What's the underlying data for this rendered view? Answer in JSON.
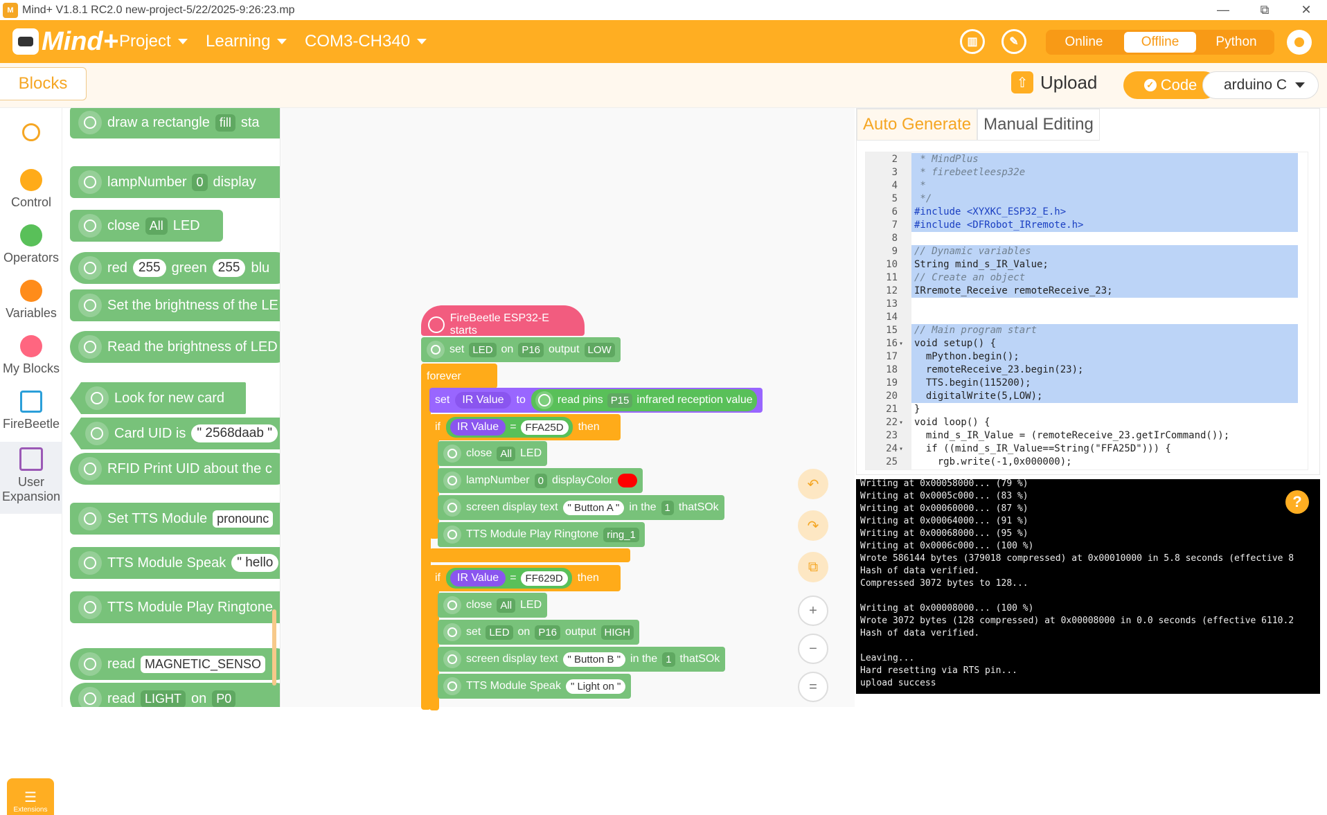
{
  "window": {
    "title": "Mind+ V1.8.1 RC2.0   new-project-5/22/2025-9:26:23.mp",
    "min": "—",
    "max": "⧉",
    "close": "✕"
  },
  "header": {
    "brand": "Mind+",
    "menus": [
      {
        "label": "Project"
      },
      {
        "label": "Learning"
      },
      {
        "label": "COM3-CH340"
      }
    ],
    "modes": {
      "online": "Online",
      "offline": "Offline",
      "python": "Python",
      "selected": "Offline"
    }
  },
  "toolbar": {
    "blocks_tab": "Blocks",
    "upload": "Upload",
    "code": "Code",
    "language": "arduino C"
  },
  "sidebar": {
    "items": [
      {
        "label": "Control",
        "color": "#ffab19"
      },
      {
        "label": "Operators",
        "color": "#59c059"
      },
      {
        "label": "Variables",
        "color": "#ff8c1a"
      },
      {
        "label": "My Blocks",
        "color": "#ff6680"
      },
      {
        "label": "FireBeetle"
      },
      {
        "label": "User Expansion"
      }
    ],
    "extensions": "Extensions"
  },
  "palette": {
    "b1": {
      "text": "draw a rectangle",
      "dd": "fill",
      "tail": "sta"
    },
    "b2": {
      "text": "lampNumber",
      "dd": "0",
      "tail": "display"
    },
    "b3": {
      "text": "close",
      "dd": "All",
      "tail": "LED"
    },
    "b4": {
      "red": "red",
      "rv": "255",
      "green": "green",
      "gv": "255",
      "tail": "blu"
    },
    "b5": {
      "text": "Set the brightness of the LE"
    },
    "b6": {
      "text": "Read the brightness of LED"
    },
    "b7": {
      "text": "Look for new card"
    },
    "b8": {
      "text": "Card UID is",
      "value": "\" 2568daab \""
    },
    "b9": {
      "text": "RFID Print UID about the c"
    },
    "b10": {
      "text": "Set TTS Module",
      "tail": "pronounc"
    },
    "b11": {
      "text": "TTS Module Speak",
      "value": "\" hello"
    },
    "b12": {
      "text": "TTS Module Play Ringtone"
    },
    "b13": {
      "text": "read",
      "value": "MAGNETIC_SENSO"
    },
    "b14": {
      "text": "read",
      "dd": "LIGHT",
      "on": "on",
      "pin": "P0"
    }
  },
  "script": {
    "hat": "FireBeetle ESP32-E starts",
    "set1": {
      "set": "set",
      "dev": "LED",
      "on": "on",
      "pin": "P16",
      "output": "output",
      "level": "LOW"
    },
    "forever": "forever",
    "setvar": {
      "set": "set",
      "var": "IR Value",
      "to": "to",
      "read": "read pins",
      "pin": "P15",
      "tail": "infrared reception value"
    },
    "if1": {
      "if": "if",
      "var": "IR Value",
      "eq": "=",
      "val": "FFA25D",
      "then": "then"
    },
    "c1": {
      "close": "close",
      "dd": "All",
      "led": "LED"
    },
    "c2": {
      "text": "lampNumber",
      "dd": "0",
      "dc": "displayColor"
    },
    "c3": {
      "text": "screen display text",
      "val": "\" Button A \"",
      "inthe": "in the",
      "dd": "1",
      "tail": "thatSOk"
    },
    "c4": {
      "text": "TTS Module Play Ringtone",
      "dd": "ring_1"
    },
    "if2": {
      "if": "if",
      "var": "IR Value",
      "eq": "=",
      "val": "FF629D",
      "then": "then"
    },
    "d1": {
      "close": "close",
      "dd": "All",
      "led": "LED"
    },
    "d2": {
      "set": "set",
      "dev": "LED",
      "on": "on",
      "pin": "P16",
      "output": "output",
      "level": "HIGH"
    },
    "d3": {
      "text": "screen display text",
      "val": "\" Button B \"",
      "inthe": "in the",
      "dd": "1",
      "tail": "thatSOk"
    },
    "d4": {
      "text": "TTS Module Speak",
      "val": "\" Light on \""
    }
  },
  "zoom": {
    "undo": "↶",
    "redo": "↷",
    "crop": "⧉",
    "in": "+",
    "out": "−",
    "reset": "="
  },
  "code": {
    "tabs": {
      "auto": "Auto Generate",
      "manual": "Manual Editing"
    },
    "lines": [
      {
        "n": "2",
        "t": " * MindPlus"
      },
      {
        "n": "3",
        "t": " * firebeetleesp32e"
      },
      {
        "n": "4",
        "t": " *"
      },
      {
        "n": "5",
        "t": " */"
      },
      {
        "n": "6",
        "t": "#include <XYXKC_ESP32_E.h>"
      },
      {
        "n": "7",
        "t": "#include <DFRobot_IRremote.h>"
      },
      {
        "n": "8",
        "t": ""
      },
      {
        "n": "9",
        "t": "// Dynamic variables"
      },
      {
        "n": "10",
        "t": "String mind_s_IR_Value;"
      },
      {
        "n": "11",
        "t": "// Create an object"
      },
      {
        "n": "12",
        "t": "IRremote_Receive remoteReceive_23;"
      },
      {
        "n": "13",
        "t": ""
      },
      {
        "n": "14",
        "t": ""
      },
      {
        "n": "15",
        "t": "// Main program start"
      },
      {
        "n": "16",
        "t": "void setup() {"
      },
      {
        "n": "17",
        "t": "  mPython.begin();"
      },
      {
        "n": "18",
        "t": "  remoteReceive_23.begin(23);"
      },
      {
        "n": "19",
        "t": "  TTS.begin(115200);"
      },
      {
        "n": "20",
        "t": "  digitalWrite(5,LOW);"
      },
      {
        "n": "21",
        "t": "}"
      },
      {
        "n": "22",
        "t": "void loop() {"
      },
      {
        "n": "23",
        "t": "  mind_s_IR_Value = (remoteReceive_23.getIrCommand());"
      },
      {
        "n": "24",
        "t": "  if ((mind_s_IR_Value==String(\"FFA25D\"))) {"
      },
      {
        "n": "25",
        "t": "    rgb.write(-1,0x000000);"
      }
    ]
  },
  "console": {
    "lines": [
      "Writing at 0x00058000... (79 %)",
      "Writing at 0x0005c000... (83 %)",
      "Writing at 0x00060000... (87 %)",
      "Writing at 0x00064000... (91 %)",
      "Writing at 0x00068000... (95 %)",
      "Writing at 0x0006c000... (100 %)",
      "Wrote 586144 bytes (379018 compressed) at 0x00010000 in 5.8 seconds (effective 8",
      "Hash of data verified.",
      "Compressed 3072 bytes to 128...",
      "",
      "Writing at 0x00008000... (100 %)",
      "Wrote 3072 bytes (128 compressed) at 0x00008000 in 0.0 seconds (effective 6110.2",
      "Hash of data verified.",
      "",
      "Leaving...",
      "Hard resetting via RTS pin...",
      "upload success"
    ],
    "help": "?"
  }
}
